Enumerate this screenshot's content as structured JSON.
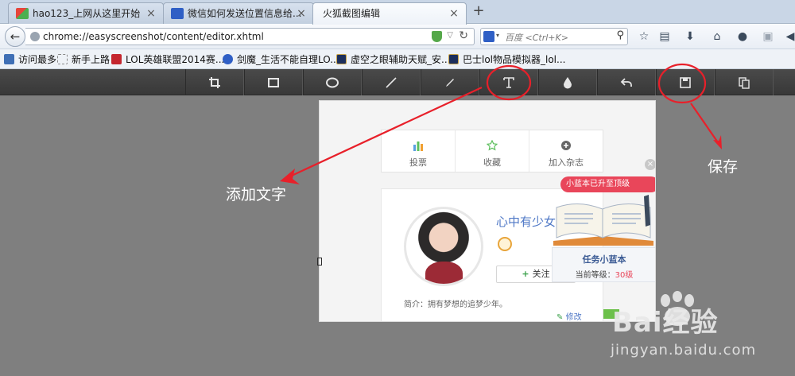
{
  "browser": {
    "tabs": [
      {
        "title": "hao123_上网从这里开始"
      },
      {
        "title": "微信如何发送位置信息给..."
      },
      {
        "title": "火狐截图编辑"
      }
    ],
    "address_url": "chrome://easyscreenshot/content/editor.xhtml",
    "search_placeholder": "百度 <Ctrl+K>",
    "bookmarks": [
      {
        "label": "访问最多"
      },
      {
        "label": "新手上路"
      },
      {
        "label": "LOL英雄联盟2014赛..."
      },
      {
        "label": "剑魔_生活不能自理LO..."
      },
      {
        "label": "虚空之眼辅助天赋_安..."
      },
      {
        "label": "巴士lol物品模拟器_lol..."
      }
    ],
    "nav_icons": [
      "star-icon",
      "reading-list-icon",
      "download-icon",
      "home-icon",
      "chat-icon",
      "screenshot-icon",
      "more-icon"
    ]
  },
  "editor": {
    "tools": [
      {
        "name": "crop",
        "icon": "crop-icon"
      },
      {
        "name": "rectangle",
        "icon": "rectangle-icon"
      },
      {
        "name": "ellipse",
        "icon": "ellipse-icon"
      },
      {
        "name": "line",
        "icon": "line-icon"
      },
      {
        "name": "pen",
        "icon": "pen-icon"
      },
      {
        "name": "text",
        "icon": "text-icon"
      },
      {
        "name": "blur",
        "icon": "blur-icon"
      },
      {
        "name": "undo",
        "icon": "undo-icon"
      },
      {
        "name": "save",
        "icon": "save-icon"
      },
      {
        "name": "copy",
        "icon": "copy-icon"
      }
    ],
    "annotations": {
      "add_text": "添加文字",
      "save": "保存",
      "annotation_color": "#e8202a"
    }
  },
  "captured": {
    "actions": [
      {
        "label": "投票"
      },
      {
        "label": "收藏"
      },
      {
        "label": "加入杂志"
      }
    ],
    "username": "心中有少女",
    "follow_label": "关注",
    "bio": "简介：拥有梦想的追梦少年。",
    "edit_label": "修改",
    "task_bubble": "小蓝本已升至顶级",
    "task_title": "任务小蓝本",
    "task_level_label": "当前等级：",
    "task_level_value": "30级"
  },
  "watermark": {
    "logo": "Bai经验",
    "url": "jingyan.baidu.com"
  }
}
